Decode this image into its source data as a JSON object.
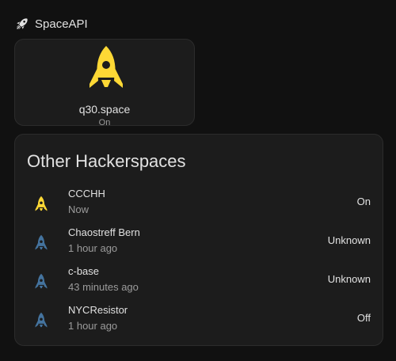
{
  "header": {
    "title": "SpaceAPI",
    "icon": "rocket-launch-icon"
  },
  "tile": {
    "name": "q30.space",
    "state": "On",
    "icon": "rocket-icon",
    "icon_color": "#fdd835"
  },
  "card": {
    "title": "Other Hackerspaces",
    "rows": [
      {
        "name": "CCCHH",
        "time": "Now",
        "state": "On",
        "icon": "rocket-icon",
        "icon_color": "#fdd835"
      },
      {
        "name": "Chaostreff Bern",
        "time": "1 hour ago",
        "state": "Unknown",
        "icon": "rocket-icon",
        "icon_color": "#44739e"
      },
      {
        "name": "c-base",
        "time": "43 minutes ago",
        "state": "Unknown",
        "icon": "rocket-icon",
        "icon_color": "#44739e"
      },
      {
        "name": "NYCResistor",
        "time": "1 hour ago",
        "state": "Off",
        "icon": "rocket-icon",
        "icon_color": "#44739e"
      }
    ]
  },
  "colors": {
    "background": "#111111",
    "card_background": "#1c1c1c",
    "primary_text": "#e1e1e1",
    "secondary_text": "#9b9b9b",
    "active": "#fdd835",
    "inactive": "#44739e"
  }
}
